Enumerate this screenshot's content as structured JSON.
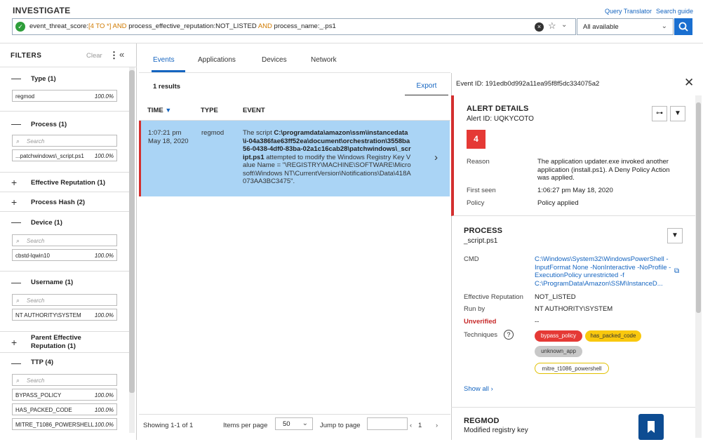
{
  "header": {
    "title": "INVESTIGATE",
    "query_translator": "Query Translator",
    "search_guide": "Search guide"
  },
  "query": {
    "parts": [
      {
        "text": "event_threat_score:",
        "kw": false
      },
      {
        "text": "[4 TO *]",
        "kw": true
      },
      {
        "text": " AND ",
        "kw": true
      },
      {
        "text": "process_effective_reputation:NOT_LISTED",
        "kw": false
      },
      {
        "text": " AND ",
        "kw": true
      },
      {
        "text": "process_name:_.ps1",
        "kw": false
      }
    ],
    "scope": "All available"
  },
  "filters": {
    "title": "FILTERS",
    "clear": "Clear",
    "search_placeholder": "Search",
    "type": {
      "label": "Type (1)",
      "rows": [
        {
          "name": "regmod",
          "pct": "100.0%"
        }
      ]
    },
    "process": {
      "label": "Process (1)",
      "rows": [
        {
          "name": "...patchwindows\\_script.ps1",
          "pct": "100.0%"
        }
      ]
    },
    "effective_reputation": {
      "label": "Effective Reputation (1)"
    },
    "process_hash": {
      "label": "Process Hash (2)"
    },
    "device": {
      "label": "Device (1)",
      "rows": [
        {
          "name": "cbstd-lqwin10",
          "pct": "100.0%"
        }
      ]
    },
    "username": {
      "label": "Username (1)",
      "rows": [
        {
          "name": "NT AUTHORITY\\SYSTEM",
          "pct": "100.0%"
        }
      ]
    },
    "parent_rep": {
      "label": "Parent Effective Reputation (1)"
    },
    "ttp": {
      "label": "TTP (4)",
      "rows": [
        {
          "name": "BYPASS_POLICY",
          "pct": "100.0%"
        },
        {
          "name": "HAS_PACKED_CODE",
          "pct": "100.0%"
        },
        {
          "name": "MITRE_T1086_POWERSHELL",
          "pct": "100.0%"
        }
      ]
    }
  },
  "tabs": [
    "Events",
    "Applications",
    "Devices",
    "Network"
  ],
  "results": {
    "count": "1 results",
    "export": "Export",
    "columns": [
      "TIME",
      "TYPE",
      "EVENT"
    ],
    "row": {
      "time": "1:07:21 pm",
      "date": "May 18, 2020",
      "type": "regmod",
      "event_pre": "The script ",
      "event_path": "C:\\programdata\\amazon\\ssm\\instancedata\\i-04a386fae63ff52ea\\document\\orchestration\\3558ba56-0438-4df0-83ba-02a1c16cab28\\patchwindows\\_script.ps1",
      "event_post": " attempted to modify the Windows Registry Key Value Name = \"\\REGISTRY\\MACHINE\\SOFTWARE\\Microsoft\\Windows NT\\CurrentVersion\\Notifications\\Data\\418A073AA3BC3475\"."
    },
    "pager": {
      "showing": "Showing 1-1 of 1",
      "ipp_label": "Items per page",
      "ipp_value": "50",
      "goto_label": "Jump to page",
      "page": "1"
    }
  },
  "detail": {
    "event_id": "Event ID: 191edb0d992a11ea95f8f5dc334075a2",
    "alert": {
      "title": "ALERT DETAILS",
      "alert_id": "Alert ID: UQKYCOTO",
      "score": "4",
      "reason_label": "Reason",
      "reason": "The application updater.exe invoked another application (install.ps1). A Deny Policy Action was applied.",
      "first_seen_label": "First seen",
      "first_seen": "1:06:27 pm May 18, 2020",
      "policy_label": "Policy",
      "policy": "Policy applied"
    },
    "process": {
      "title": "PROCESS",
      "name": "_script.ps1",
      "cmd_label": "CMD",
      "cmd": "C:\\Windows\\System32\\WindowsPowerShell -InputFormat None -NonInteractive -NoProfile -ExecutionPolicy unrestricted -f C:\\ProgramData\\Amazon\\SSM\\InstanceD...",
      "rep_label": "Effective Reputation",
      "rep": "NOT_LISTED",
      "runby_label": "Run by",
      "runby": "NT AUTHORITY\\SYSTEM",
      "unverified_label": "Unverified",
      "unverified": "--",
      "techniques_label": "Techniques",
      "techniques": [
        {
          "name": "bypass_policy",
          "color": "#e53935",
          "fg": "#ffffff"
        },
        {
          "name": "has_packed_code",
          "color": "#f9c80e",
          "fg": "#333333"
        },
        {
          "name": "unknown_app",
          "color": "#c8c8c8",
          "fg": "#333333"
        },
        {
          "name": "mitre_t1086_powershell",
          "color": "#ffffff",
          "fg": "#333333"
        }
      ],
      "show_all": "Show all"
    },
    "regmod": {
      "title": "REGMOD",
      "sub": "Modified registry key"
    }
  }
}
